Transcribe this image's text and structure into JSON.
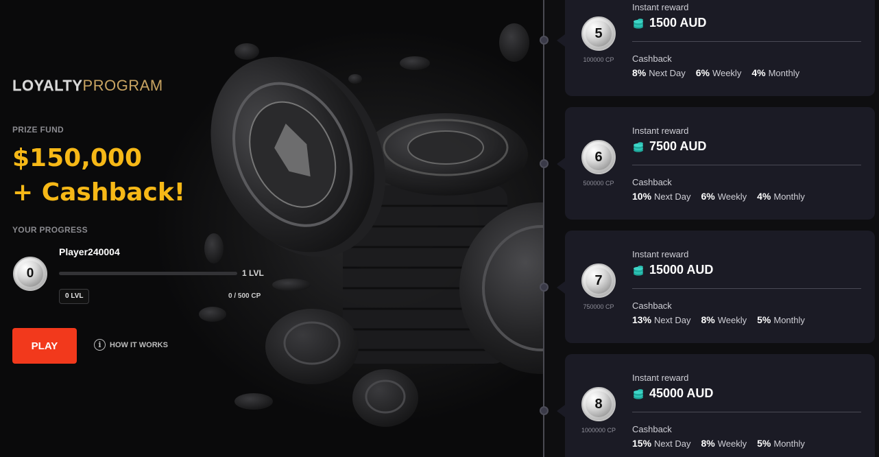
{
  "logo": {
    "part1": "LOYALTY",
    "part2": "PROGRAM"
  },
  "prize": {
    "label": "PRIZE FUND",
    "amount": "$150,000",
    "extra": "+ Cashback!"
  },
  "progress": {
    "label": "YOUR PROGRESS",
    "player": "Player240004",
    "current_level": "0",
    "current_level_badge": "0 LVL",
    "next_level": "1 LVL",
    "cp_text": "0 / 500 CP",
    "fraction": 0
  },
  "actions": {
    "play": "PLAY",
    "how": "HOW IT WORKS"
  },
  "colors": {
    "accent": "#f6b817",
    "play": "#f2391c",
    "card": "#1b1b25",
    "coins": "#2ec4b6"
  },
  "levels": [
    {
      "level": "5",
      "cp": "100000 CP",
      "reward_label": "Instant reward",
      "reward": "1500 AUD",
      "cashback_label": "Cashback",
      "next_day_pct": "8%",
      "next_day": "Next Day",
      "weekly_pct": "6%",
      "weekly": "Weekly",
      "monthly_pct": "4%",
      "monthly": "Monthly"
    },
    {
      "level": "6",
      "cp": "500000 CP",
      "reward_label": "Instant reward",
      "reward": "7500 AUD",
      "cashback_label": "Cashback",
      "next_day_pct": "10%",
      "next_day": "Next Day",
      "weekly_pct": "6%",
      "weekly": "Weekly",
      "monthly_pct": "4%",
      "monthly": "Monthly"
    },
    {
      "level": "7",
      "cp": "750000 CP",
      "reward_label": "Instant reward",
      "reward": "15000 AUD",
      "cashback_label": "Cashback",
      "next_day_pct": "13%",
      "next_day": "Next Day",
      "weekly_pct": "8%",
      "weekly": "Weekly",
      "monthly_pct": "5%",
      "monthly": "Monthly"
    },
    {
      "level": "8",
      "cp": "1000000 CP",
      "reward_label": "Instant reward",
      "reward": "45000 AUD",
      "cashback_label": "Cashback",
      "next_day_pct": "15%",
      "next_day": "Next Day",
      "weekly_pct": "8%",
      "weekly": "Weekly",
      "monthly_pct": "5%",
      "monthly": "Monthly"
    }
  ]
}
